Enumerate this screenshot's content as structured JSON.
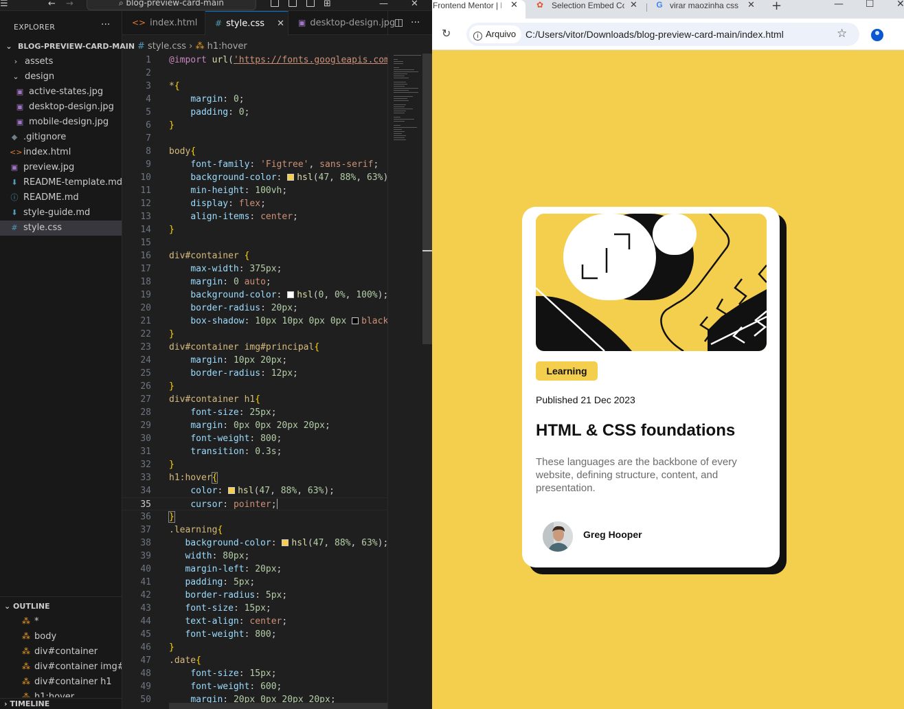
{
  "vscode": {
    "search_title": "blog-preview-card-main",
    "explorer": {
      "header": "EXPLORER",
      "root": "BLOG-PREVIEW-CARD-MAIN",
      "items": [
        {
          "label": "assets",
          "icon": "chevron-right-icon"
        },
        {
          "label": "design",
          "icon": "chevron-down-icon"
        },
        {
          "label": "active-states.jpg",
          "icon": "image-icon"
        },
        {
          "label": "desktop-design.jpg",
          "icon": "image-icon"
        },
        {
          "label": "mobile-design.jpg",
          "icon": "image-icon"
        },
        {
          "label": ".gitignore",
          "icon": "git-icon"
        },
        {
          "label": "index.html",
          "icon": "html-icon"
        },
        {
          "label": "preview.jpg",
          "icon": "image-icon"
        },
        {
          "label": "README-template.md",
          "icon": "markdown-icon"
        },
        {
          "label": "README.md",
          "icon": "info-icon"
        },
        {
          "label": "style-guide.md",
          "icon": "markdown-icon"
        },
        {
          "label": "style.css",
          "icon": "css-icon"
        }
      ]
    },
    "outline": {
      "header": "OUTLINE",
      "items": [
        "*",
        "body",
        "div#container",
        "div#container img#...",
        "div#container h1",
        "h1:hover"
      ]
    },
    "timeline_header": "TIMELINE",
    "tabs": [
      {
        "label": "index.html",
        "icon": "<>"
      },
      {
        "label": "style.css",
        "icon": "#"
      },
      {
        "label": "desktop-design.jpg",
        "icon": "▣"
      }
    ],
    "breadcrumb": {
      "file": "style.css",
      "symbol": "h1:hover"
    },
    "cursor_line": 35
  },
  "chrome": {
    "tabs": [
      {
        "title": "Frontend Mentor | E",
        "favicon": "frontendmentor-icon"
      },
      {
        "title": "Selection Embed Co",
        "favicon": "figma-icon"
      },
      {
        "title": "virar maozinha css",
        "favicon": "google-icon"
      }
    ],
    "site_label": "Arquivo",
    "url": "C:/Users/vitor/Downloads/blog-preview-card-main/index.html"
  },
  "card": {
    "tag": "Learning",
    "date": "Published 21 Dec 2023",
    "title": "HTML & CSS foundations",
    "description": "These languages are the backbone of every website, defining structure, content, and presentation.",
    "author": "Greg Hooper"
  },
  "colors": {
    "accent_yellow": "#f4ce4d",
    "editor_bg": "#1f1f1f",
    "vscode_blue": "#0078d4"
  }
}
